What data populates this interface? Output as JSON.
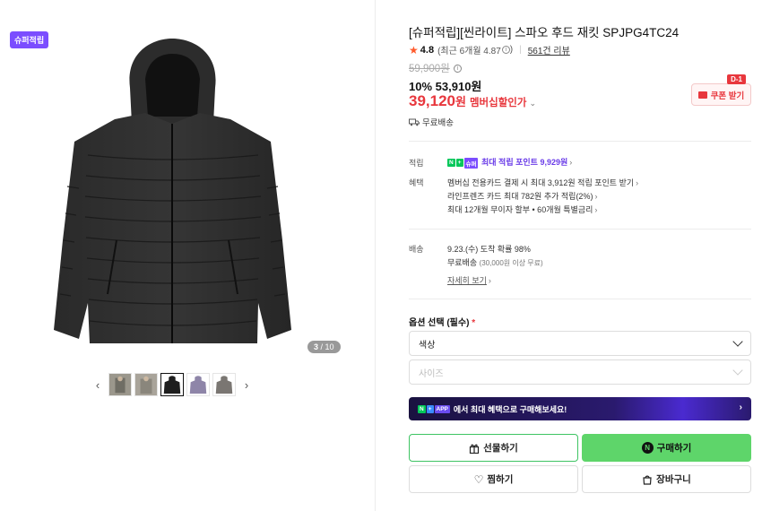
{
  "gallery": {
    "badge": "슈퍼적립",
    "counter_current": "3",
    "counter_total": "10",
    "counter_sep": " / ",
    "thumbs": [
      {
        "name": "thumb-model-1",
        "color": "#8a8a80"
      },
      {
        "name": "thumb-model-2",
        "color": "#9a958c"
      },
      {
        "name": "thumb-black-jacket",
        "color": "#1e1e1e"
      },
      {
        "name": "thumb-purple-jacket",
        "color": "#8e85a8"
      },
      {
        "name": "thumb-gray-jacket",
        "color": "#7a7672"
      }
    ],
    "prev_icon": "chevron-left-icon",
    "next_icon": "chevron-right-icon"
  },
  "product": {
    "title": "[슈퍼적립][씬라이트] 스파오 후드 재킷 SPJPG4TC24",
    "rating": "4.8",
    "rating_recent": "(최근 6개월 4.87",
    "rating_recent_close": ")",
    "review_count": "561건 리뷰",
    "original_price": "59,900원",
    "discount": "10%",
    "sale_price": "53,910원",
    "member_price": "39,120",
    "member_price_unit": "원",
    "member_label": "멤버십할인가",
    "shipping_tag": "무료배송",
    "coupon_d": "D-1",
    "coupon_label": "쿠폰 받기"
  },
  "benefits": {
    "points_label": "적립",
    "points_text": "최대 적립 포인트 9,929원",
    "benefit_label": "혜택",
    "benefit_lines": [
      "멤버십 전용카드 결제 시 최대 3,912원 적립 포인트 받기",
      "라인프렌즈 카드 최대 782원 추가 적립(2%)",
      "최대 12개월 무이자 할부 • 60개월 특별금리"
    ],
    "shipping_label": "배송",
    "delivery_eta": "9.23.(수) 도착 확률 98%",
    "shipping_free": "무료배송",
    "shipping_cond": "(30,000원 이상 무료)",
    "shipping_more": "자세히 보기"
  },
  "options": {
    "title": "옵션 선택 (필수)",
    "required_mark": "*",
    "color_select": "색상",
    "size_select": "사이즈"
  },
  "app_banner": {
    "badge_n": "N",
    "badge_plus": "+",
    "badge_app": "APP",
    "text": "에서 최대 혜택으로 구매해보세요!"
  },
  "actions": {
    "gift": "선물하기",
    "buy": "구매하기",
    "wish": "찜하기",
    "cart": "장바구니"
  },
  "colors": {
    "accent_red": "#e8373d",
    "naver_green": "#5ed56a",
    "super_purple": "#7b4dff"
  }
}
